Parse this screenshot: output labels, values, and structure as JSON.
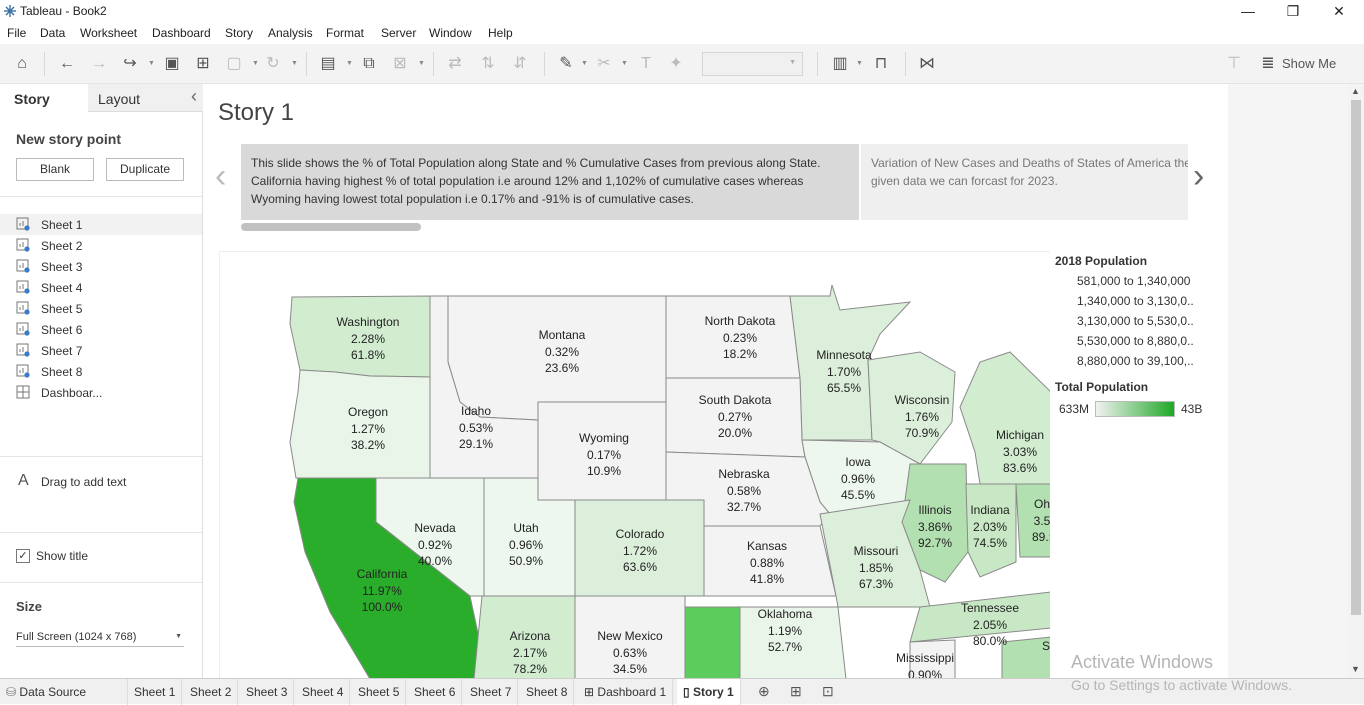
{
  "window": {
    "title": "Tableau - Book2",
    "minimize": "—",
    "restore": "❐",
    "close": "✕"
  },
  "menu": [
    "File",
    "Data",
    "Worksheet",
    "Dashboard",
    "Story",
    "Analysis",
    "Format",
    "Server",
    "Window",
    "Help"
  ],
  "toolbar": {
    "show_me": "Show Me"
  },
  "left_pane": {
    "tab_story": "Story",
    "tab_layout": "Layout",
    "collapse": "‹",
    "new_story_point": "New story point",
    "blank_button": "Blank",
    "duplicate_button": "Duplicate",
    "sheets": [
      "Sheet 1",
      "Sheet 2",
      "Sheet 3",
      "Sheet 4",
      "Sheet 5",
      "Sheet 6",
      "Sheet 7",
      "Sheet 8",
      "Dashboar..."
    ],
    "drag_text": "Drag to add text",
    "text_icon": "A",
    "show_title": "Show title",
    "show_title_checked": true,
    "size_heading": "Size",
    "size_value": "Full Screen (1024 x 768)"
  },
  "story": {
    "title": "Story 1",
    "caption1": "This slide shows the % of Total Population along State and %  Cumulative Cases  from previous along State. California having highest % of total population i.e around 12% and 1,102% of cumulative cases whereas Wyoming having lowest total population i.e 0.17% and -91% is of cumulative cases.",
    "caption2": " Variation of New Cases and Deaths of States of America the given data we can forcast for 2023.",
    "prev_arrow": "‹",
    "next_arrow": "›"
  },
  "map_states": [
    {
      "name": "Washington",
      "pct": "2.28%",
      "cum": "61.8%"
    },
    {
      "name": "Montana",
      "pct": "0.32%",
      "cum": "23.6%"
    },
    {
      "name": "North Dakota",
      "pct": "0.23%",
      "cum": "18.2%"
    },
    {
      "name": "Minnesota",
      "pct": "1.70%",
      "cum": "65.5%"
    },
    {
      "name": "Oregon",
      "pct": "1.27%",
      "cum": "38.2%"
    },
    {
      "name": "Idaho",
      "pct": "0.53%",
      "cum": "29.1%"
    },
    {
      "name": "Wyoming",
      "pct": "0.17%",
      "cum": "10.9%"
    },
    {
      "name": "South Dakota",
      "pct": "0.27%",
      "cum": "20.0%"
    },
    {
      "name": "Wisconsin",
      "pct": "1.76%",
      "cum": "70.9%"
    },
    {
      "name": "Michigan",
      "pct": "3.03%",
      "cum": "83.6%"
    },
    {
      "name": "Iowa",
      "pct": "0.96%",
      "cum": "45.5%"
    },
    {
      "name": "Nebraska",
      "pct": "0.58%",
      "cum": "32.7%"
    },
    {
      "name": "Nevada",
      "pct": "0.92%",
      "cum": "40.0%"
    },
    {
      "name": "Utah",
      "pct": "0.96%",
      "cum": "50.9%"
    },
    {
      "name": "Colorado",
      "pct": "1.72%",
      "cum": "63.6%"
    },
    {
      "name": "Illinois",
      "pct": "3.86%",
      "cum": "92.7%"
    },
    {
      "name": "Indiana",
      "pct": "2.03%",
      "cum": "74.5%"
    },
    {
      "name": "Oh",
      "pct": "3.5",
      "cum": "89.:"
    },
    {
      "name": "California",
      "pct": "11.97%",
      "cum": "100.0%"
    },
    {
      "name": "Kansas",
      "pct": "0.88%",
      "cum": "41.8%"
    },
    {
      "name": "Missouri",
      "pct": "1.85%",
      "cum": "67.3%"
    },
    {
      "name": "Tennessee",
      "pct": "2.05%",
      "cum": "80.0%"
    },
    {
      "name": "Arizona",
      "pct": "2.17%",
      "cum": "78.2%"
    },
    {
      "name": "New Mexico",
      "pct": "0.63%",
      "cum": "34.5%"
    },
    {
      "name": "Oklahoma",
      "pct": "1.19%",
      "cum": "52.7%"
    },
    {
      "name": "Mississippi",
      "pct": "0.90%",
      "cum": ""
    },
    {
      "name": "S",
      "pct": "",
      "cum": ""
    }
  ],
  "legend": {
    "pop_title": "2018 Population",
    "pop_ranges": [
      "581,000 to 1,340,000",
      "1,340,000 to 3,130,0..",
      "3,130,000 to 5,530,0..",
      "5,530,000 to 8,880,0..",
      "8,880,000 to 39,100,.."
    ],
    "total_title": "Total Population",
    "min": "633M",
    "max": "43B",
    "color_low": "#f2f2f2",
    "color_high": "#1fa827"
  },
  "bottom_tabs": [
    "Data Source",
    "Sheet 1",
    "Sheet 2",
    "Sheet 3",
    "Sheet 4",
    "Sheet 5",
    "Sheet 6",
    "Sheet 7",
    "Sheet 8",
    "Dashboard 1",
    "Story 1"
  ],
  "watermark": {
    "line1": "Activate Windows",
    "line2": "Go to Settings to activate Windows."
  }
}
